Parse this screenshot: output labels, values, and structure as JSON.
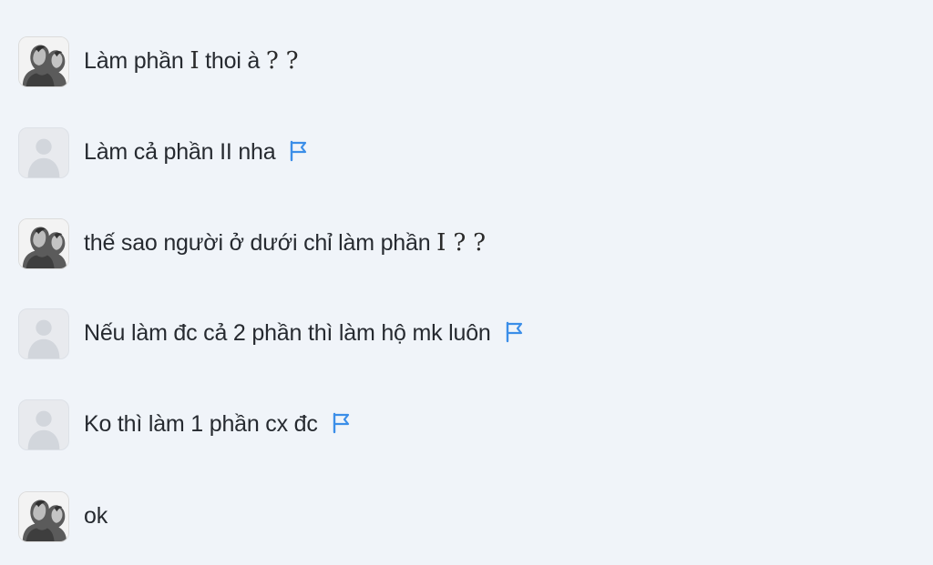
{
  "comments": [
    {
      "avatar": "photo-avatar",
      "text": "Làm phần ",
      "mark": "I",
      "after": " thoi à ",
      "qs": "? ?",
      "flag": false
    },
    {
      "avatar": "default-avatar",
      "text": "Làm cả phần II nha",
      "flag": true,
      "flag_icon": "flag-icon"
    },
    {
      "avatar": "photo-avatar",
      "text": "thế sao người ở dưới chỉ làm phần ",
      "mark": "I",
      "qs": " ? ?",
      "flag": false
    },
    {
      "avatar": "default-avatar",
      "text": "Nếu làm đc cả 2 phần thì làm hộ mk luôn",
      "flag": true,
      "flag_icon": "flag-icon"
    },
    {
      "avatar": "default-avatar",
      "text": "Ko thì làm 1 phần cx đc",
      "flag": true,
      "flag_icon": "flag-icon"
    },
    {
      "avatar": "photo-avatar",
      "text": "ok",
      "flag": false
    }
  ],
  "colors": {
    "background": "#f0f4f9",
    "text": "#262a30",
    "flag": "#3b8ee8",
    "default_avatar_bg": "#e8eaee",
    "default_avatar_silhouette": "#d2d6dc"
  }
}
